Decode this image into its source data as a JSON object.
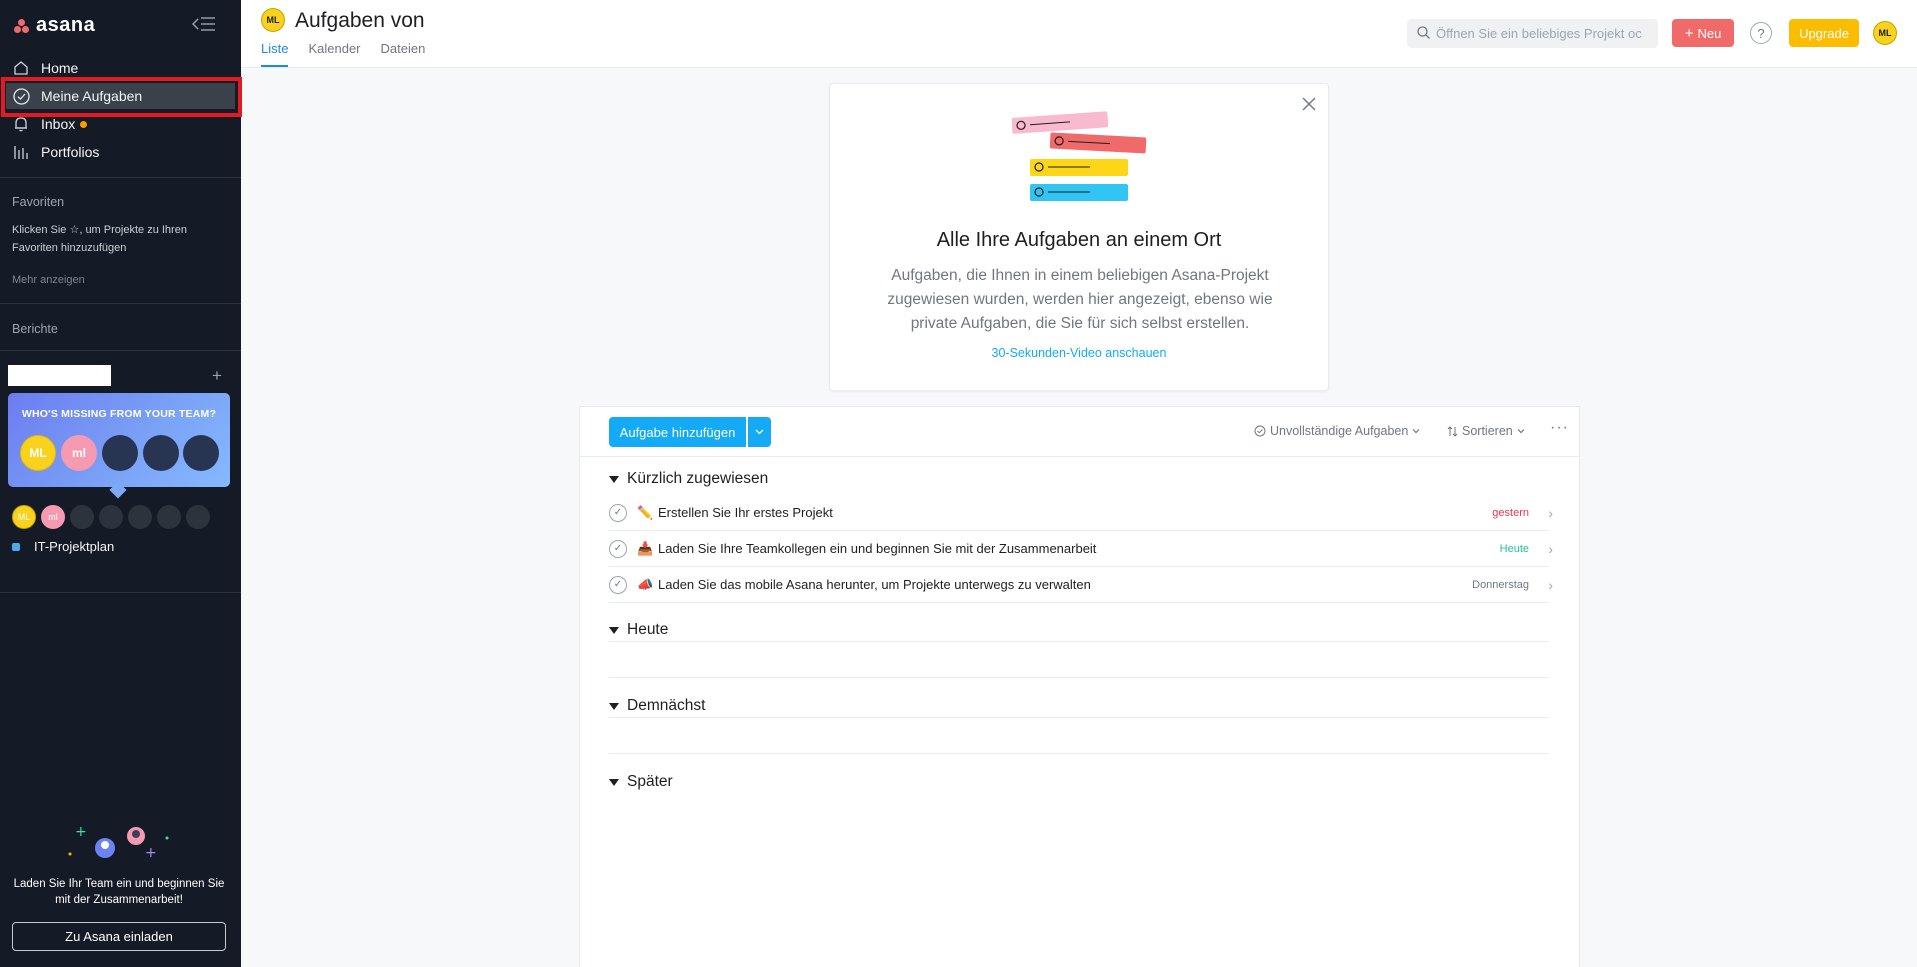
{
  "sidebar": {
    "logo_text": "asana",
    "nav": [
      {
        "label": "Home",
        "icon": "home-icon"
      },
      {
        "label": "Meine Aufgaben",
        "icon": "check-circle-icon"
      },
      {
        "label": "Inbox",
        "icon": "bell-icon"
      },
      {
        "label": "Portfolios",
        "icon": "bar-chart-icon"
      }
    ],
    "favorites_heading": "Favoriten",
    "favorites_hint_1": "Klicken Sie ☆, um Projekte zu Ihren",
    "favorites_hint_2": "Favoriten hinzuzufügen",
    "show_more": "Mehr anzeigen",
    "reports_heading": "Berichte",
    "invite_card_title": "WHO'S MISSING FROM YOUR TEAM?",
    "invite_avatars": [
      "ML",
      "ml"
    ],
    "mini_avatars": [
      "ML",
      "ml"
    ],
    "project": "IT-Projektplan",
    "bottom_text": "Laden Sie Ihr Team ein und beginnen Sie mit der Zusammenarbeit!",
    "invite_button": "Zu Asana einladen"
  },
  "header": {
    "avatar": "ML",
    "title": "Aufgaben von",
    "tabs": [
      "Liste",
      "Kalender",
      "Dateien"
    ],
    "search_placeholder": "Öffnen Sie ein beliebiges Projekt oc",
    "new_button": "Neu",
    "help": "?",
    "upgrade_button": "Upgrade",
    "user_avatar": "ML"
  },
  "intro": {
    "title": "Alle Ihre Aufgaben an einem Ort",
    "body": "Aufgaben, die Ihnen in einem beliebigen Asana-Projekt zugewiesen wurden, werden hier angezeigt, ebenso wie private Aufgaben, die Sie für sich selbst erstellen.",
    "link": "30-Sekunden-Video anschauen"
  },
  "tasks": {
    "add_button": "Aufgabe hinzufügen",
    "filter": "Unvollständige Aufgaben",
    "sort": "Sortieren",
    "sections": [
      {
        "title": "Kürzlich zugewiesen"
      },
      {
        "title": "Heute"
      },
      {
        "title": "Demnächst"
      },
      {
        "title": "Später"
      }
    ],
    "rows": [
      {
        "emoji": "✏️",
        "title": "Erstellen Sie Ihr erstes Projekt",
        "due": "gestern",
        "due_color": "#e8384f"
      },
      {
        "emoji": "📥",
        "title": "Laden Sie Ihre Teamkollegen ein und beginnen Sie mit der Zusammenarbeit",
        "due": "Heute",
        "due_color": "#25c1a1"
      },
      {
        "emoji": "📣",
        "title": "Laden Sie das mobile Asana herunter, um Projekte unterwegs zu verwalten",
        "due": "Donnerstag",
        "due_color": "#6f7782"
      }
    ]
  },
  "colors": {
    "sidebar_bg": "#151b26",
    "accent_blue": "#14aaf5",
    "new_button": "#f06a6a",
    "upgrade_button": "#fcbd01",
    "highlight": "#e21b23"
  }
}
